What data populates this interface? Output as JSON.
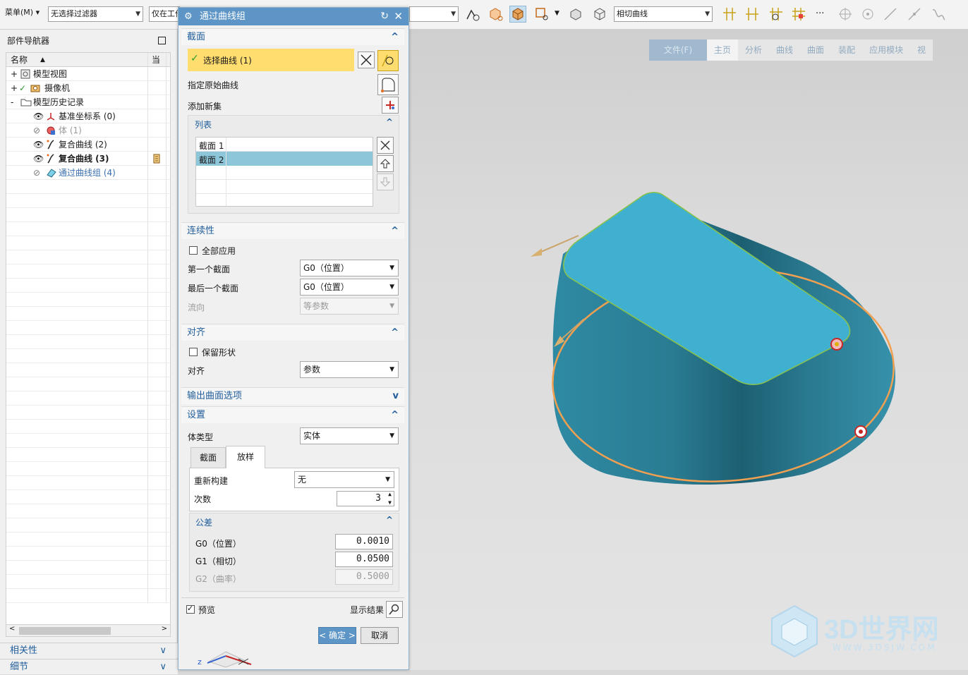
{
  "toolbar": {
    "menu_label": "菜单(M) ▾",
    "filter_select": "无选择过滤器",
    "scope_select": "仅在工作",
    "curve_rule_select": "相切曲线",
    "more_label": "···"
  },
  "ribbon": {
    "tabs": [
      "文件(F)",
      "主页",
      "分析",
      "曲线",
      "曲面",
      "装配",
      "应用模块",
      "视"
    ]
  },
  "navigator": {
    "title": "部件导航器",
    "col_name": "名称",
    "col_current": "当",
    "rows": [
      {
        "label": "模型视图",
        "indent": 0,
        "expander": "+"
      },
      {
        "label": "摄像机",
        "indent": 0,
        "expander": "+"
      },
      {
        "label": "模型历史记录",
        "indent": 0,
        "expander": "-"
      },
      {
        "label": "基准坐标系 (0)",
        "indent": 1,
        "expander": ""
      },
      {
        "label": "体 (1)",
        "indent": 1,
        "expander": "",
        "muted": true
      },
      {
        "label": "复合曲线 (2)",
        "indent": 1,
        "expander": ""
      },
      {
        "label": "复合曲线 (3)",
        "indent": 1,
        "expander": "",
        "bold": true
      },
      {
        "label": "通过曲线组 (4)",
        "indent": 1,
        "expander": "",
        "link": true
      }
    ],
    "panels": [
      "相关性",
      "细节"
    ]
  },
  "dialog": {
    "title": "通过曲线组",
    "section_sections": "截面",
    "select_curve": "选择曲线 (1)",
    "specify_origin": "指定原始曲线",
    "add_new_set": "添加新集",
    "list_title": "列表",
    "list_items": [
      "截面 1",
      "截面 2"
    ],
    "continuity_title": "连续性",
    "apply_all": "全部应用",
    "first_section": "第一个截面",
    "first_section_value": "G0（位置）",
    "last_section": "最后一个截面",
    "last_section_value": "G0（位置）",
    "flow_direction": "流向",
    "flow_direction_value": "等参数",
    "alignment_title": "对齐",
    "preserve_shape": "保留形状",
    "alignment_label": "对齐",
    "alignment_value": "参数",
    "output_options_title": "输出曲面选项",
    "settings_title": "设置",
    "body_type": "体类型",
    "body_type_value": "实体",
    "tab_section": "截面",
    "tab_loft": "放样",
    "rebuild": "重新构建",
    "rebuild_value": "无",
    "degree": "次数",
    "degree_value": "3",
    "tolerance_title": "公差",
    "g0_label": "G0（位置）",
    "g0_value": "0.0010",
    "g1_label": "G1（相切）",
    "g1_value": "0.0500",
    "g2_label": "G2（曲率）",
    "g2_value": "0.5000",
    "preview": "预览",
    "show_result": "显示结果",
    "ok": "< 确定 >",
    "cancel": "取消"
  },
  "watermark": {
    "brand": "3D世界网",
    "url": "WWW.3DSJW.COM"
  },
  "colors": {
    "accent": "#5c95c6",
    "selection_highlight": "#ffdd6e",
    "list_selected": "#8dc6d8",
    "surface_top": "#3fb0cf",
    "surface_side": "#2a7c92",
    "curve_highlight": "#f0a050"
  }
}
